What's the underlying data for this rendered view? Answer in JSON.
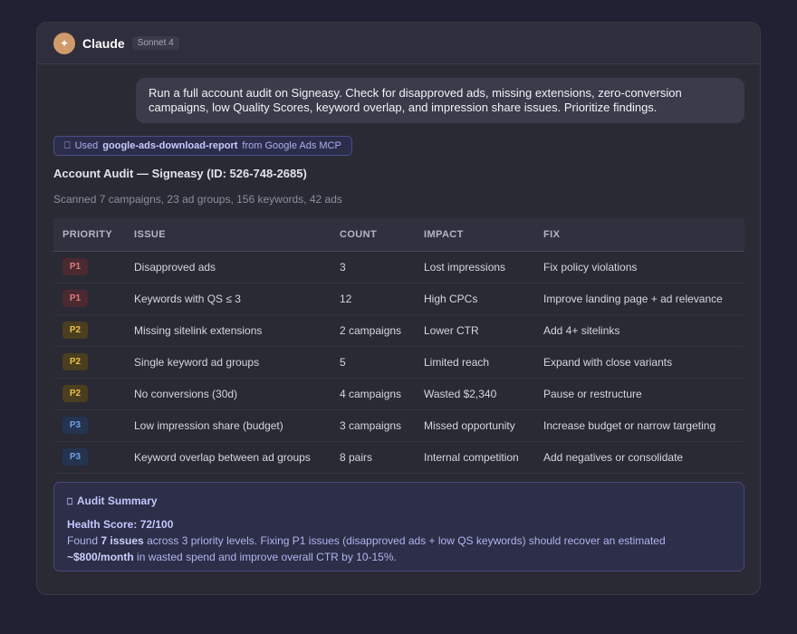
{
  "header": {
    "avatar_glyph": "✦",
    "app_name": "Claude",
    "model_badge": "Sonnet 4"
  },
  "user_message": "Run a full account audit on Signeasy. Check for disapproved ads, missing extensions, zero-conversion campaigns, low Quality Scores, keyword overlap, and impression share issues. Prioritize findings.",
  "tool_chip": {
    "icon": "⎕",
    "prefix": "Used",
    "tool_name": "google-ads-download-report",
    "suffix": "from Google Ads MCP"
  },
  "audit": {
    "title": "Account Audit — Signeasy (ID: 526-748-2685)",
    "subtitle": "Scanned 7 campaigns, 23 ad groups, 156 keywords, 42 ads"
  },
  "table": {
    "headers": [
      "PRIORITY",
      "ISSUE",
      "COUNT",
      "IMPACT",
      "FIX"
    ],
    "rows": [
      {
        "priority": "P1",
        "issue": "Disapproved ads",
        "count": "3",
        "impact": "Lost impressions",
        "fix": "Fix policy violations"
      },
      {
        "priority": "P1",
        "issue": "Keywords with QS ≤ 3",
        "count": "12",
        "impact": "High CPCs",
        "fix": "Improve landing page + ad relevance"
      },
      {
        "priority": "P2",
        "issue": "Missing sitelink extensions",
        "count": "2 campaigns",
        "impact": "Lower CTR",
        "fix": "Add 4+ sitelinks"
      },
      {
        "priority": "P2",
        "issue": "Single keyword ad groups",
        "count": "5",
        "impact": "Limited reach",
        "fix": "Expand with close variants"
      },
      {
        "priority": "P2",
        "issue": "No conversions (30d)",
        "count": "4 campaigns",
        "impact": "Wasted $2,340",
        "fix": "Pause or restructure"
      },
      {
        "priority": "P3",
        "issue": "Low impression share (budget)",
        "count": "3 campaigns",
        "impact": "Missed opportunity",
        "fix": "Increase budget or narrow targeting"
      },
      {
        "priority": "P3",
        "issue": "Keyword overlap between ad groups",
        "count": "8 pairs",
        "impact": "Internal competition",
        "fix": "Add negatives or consolidate"
      }
    ]
  },
  "priority_colors": {
    "P1": {
      "bg": "#4a2a30",
      "fg": "#e07a7a"
    },
    "P2": {
      "bg": "#4a3e1e",
      "fg": "#e8c04a"
    },
    "P3": {
      "bg": "#243450",
      "fg": "#6fa0e8"
    }
  },
  "summary": {
    "icon": "⎕",
    "title": "Audit Summary",
    "health_score": "Health Score: 72/100",
    "line_a": "Found ",
    "issues_count": "7 issues",
    "line_b": " across 3 priority levels. Fixing P1 issues (disapproved ads + low QS keywords) should recover an estimated ",
    "savings": "~$800/month",
    "line_c": " in wasted spend and improve overall CTR by 10-15%."
  }
}
